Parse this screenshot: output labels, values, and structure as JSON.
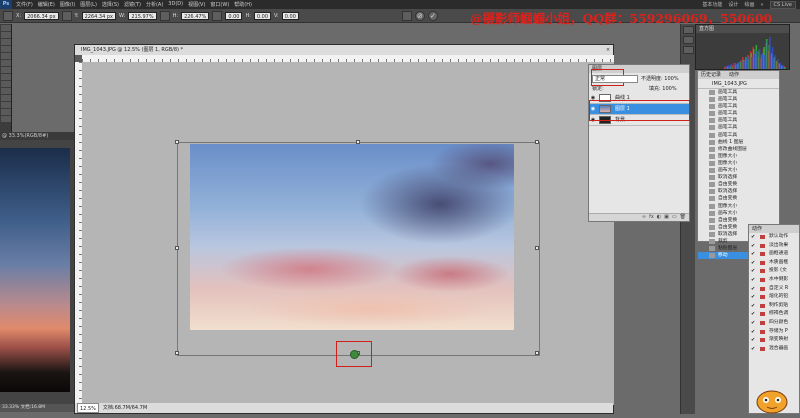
{
  "app": {
    "logo": "Ps",
    "menus": [
      "文件(F)",
      "编辑(E)",
      "图像(I)",
      "图层(L)",
      "选择(S)",
      "滤镜(T)",
      "分析(A)",
      "3D(D)",
      "视图(V)",
      "窗口(W)",
      "帮助(H)"
    ],
    "right_items": [
      "基本功能",
      "设计",
      "绘画",
      "»",
      "CS Live"
    ]
  },
  "options": {
    "x_label": "X:",
    "x_value": "2066.34 px",
    "y_label": "Y:",
    "y_value": "2264.34 px",
    "w_label": "W:",
    "w_value": "215.97%",
    "h_label": "H:",
    "h_value": "226.47%",
    "angle_value": "0.00",
    "hskew_label": "H:",
    "hskew_value": "0.00",
    "vskew_label": "V:",
    "vskew_value": "0.00",
    "cancel_symbol": "⊘",
    "commit_symbol": "✓"
  },
  "watermark": "@摄影师蝈蝈小姐，QQ群：559296069，550600",
  "back_document": {
    "title": "@ 33.3%(RGB/8#)",
    "status": "33.33%   文档:16.8M"
  },
  "main_document": {
    "title": "IMG_1043.JPG @ 12.5% (图层 1, RGB/8) *",
    "close_symbol": "×",
    "zoom": "12.5%",
    "doc_size": "文档:68.7M/64.7M"
  },
  "histogram": {
    "tab": "直方图",
    "bars_red": [
      2,
      3,
      2,
      4,
      6,
      5,
      8,
      12,
      10,
      14,
      18,
      22,
      16,
      12,
      10,
      20,
      26,
      18,
      14,
      10,
      8,
      6,
      4,
      3
    ],
    "bars_green": [
      1,
      2,
      3,
      2,
      4,
      6,
      7,
      9,
      12,
      10,
      16,
      20,
      24,
      18,
      14,
      22,
      30,
      24,
      16,
      12,
      8,
      5,
      3,
      2
    ],
    "bars_blue": [
      3,
      4,
      5,
      6,
      5,
      7,
      9,
      8,
      11,
      13,
      12,
      15,
      18,
      20,
      16,
      14,
      28,
      32,
      22,
      14,
      10,
      6,
      4,
      2
    ]
  },
  "layers_panel": {
    "tab": "图层",
    "blend_mode": "正常",
    "opacity_label": "不透明度:",
    "opacity_value": "100%",
    "fill_label": "填充:",
    "fill_value": "100%",
    "lock_label": "锁定:",
    "layers": [
      {
        "name": "曲线 1",
        "selected": false
      },
      {
        "name": "图层 1",
        "selected": true
      },
      {
        "name": "背景",
        "selected": false
      }
    ],
    "bottom_icons": [
      "∞",
      "fx",
      "◐",
      "▣",
      "▭",
      "🗑"
    ]
  },
  "history_panel": {
    "tabs": [
      "历史记录",
      "动作"
    ],
    "snapshot": "IMG_1043.JPG",
    "items": [
      "画笔工具",
      "画笔工具",
      "画笔工具",
      "画笔工具",
      "画笔工具",
      "画笔工具",
      "画笔工具",
      "曲线 1 图层",
      "修改曲线图层",
      "图像大小",
      "图像大小",
      "画布大小",
      "取消选择",
      "自由变换",
      "取消选择",
      "自由变换",
      "图像大小",
      "画布大小",
      "自由变换",
      "自由变换",
      "取消选择",
      "裁剪",
      "粘贴图层",
      "移动"
    ],
    "selected_index": 23
  },
  "actions_panel": {
    "tab": "动作",
    "items": [
      "默认动作",
      "淡出效果",
      "画框通道",
      "木质画框",
      "投影 (文",
      "水中倒影",
      "自定义 R",
      "熔化的铅",
      "制作剪贴",
      "棕褐色调",
      "四分颜色",
      "存储为 P",
      "渐变映射",
      "混合器画"
    ]
  }
}
